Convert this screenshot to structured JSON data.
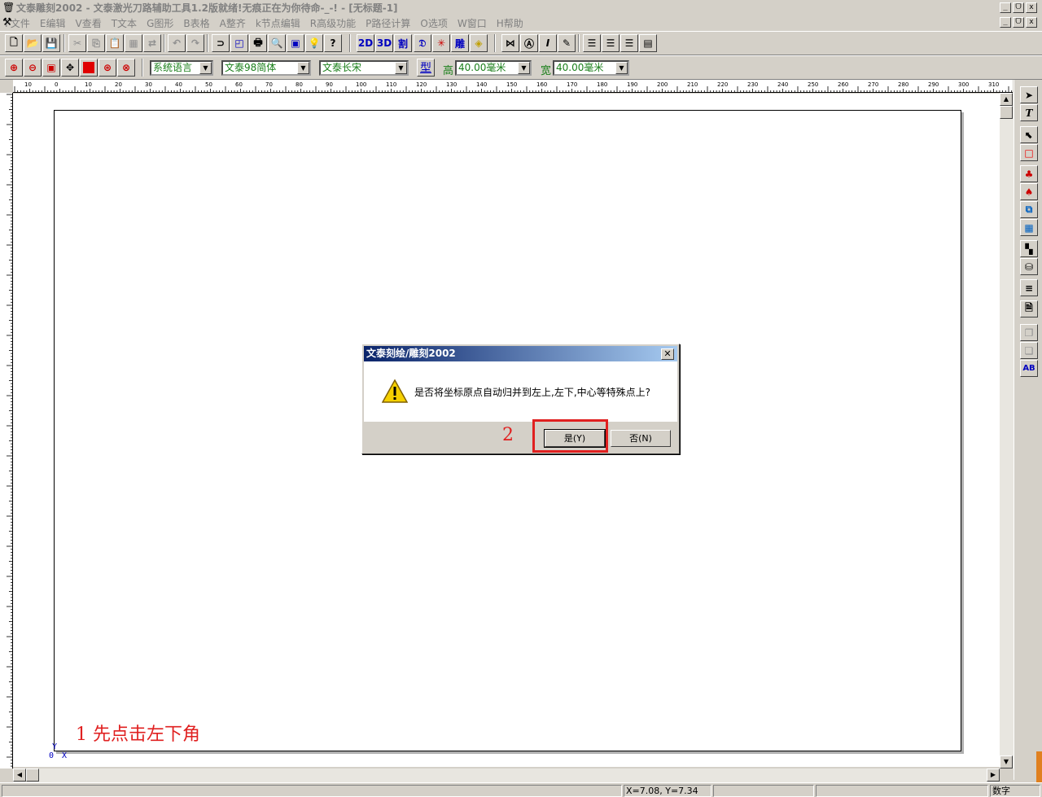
{
  "window": {
    "title": "文泰雕刻2002 - 文泰激光刀路辅助工具1.2版就绪!无痕正在为你待命-_-! - [无标题-1]",
    "buttons": [
      "_",
      "ᗜ",
      "x"
    ]
  },
  "menu": [
    "F文件",
    "E编辑",
    "V查看",
    "T文本",
    "G图形",
    "B表格",
    "A整齐",
    "k节点编辑",
    "R高级功能",
    "P路径计算",
    "O选项",
    "W窗口",
    "H帮助"
  ],
  "toolbar2": {
    "language": "系统语言",
    "font1": "文泰98简体",
    "font2": "文泰长宋",
    "type_label": "型",
    "height_label": "高",
    "height_value": "40.00毫米",
    "width_label": "宽",
    "width_value": "40.00毫米"
  },
  "toolbar1_text": {
    "b2d": "2D",
    "b3d": "3D",
    "cut": "割",
    "carve": "雕"
  },
  "ruler": {
    "h_labels": [
      "10",
      "0",
      "10",
      "20",
      "30",
      "40",
      "50",
      "60",
      "70",
      "80",
      "90",
      "100",
      "110",
      "120",
      "130",
      "140",
      "150",
      "160",
      "170",
      "180",
      "190",
      "200",
      "210",
      "220",
      "230",
      "240",
      "250",
      "260",
      "270",
      "280",
      "290",
      "300",
      "310"
    ]
  },
  "dialog": {
    "title": "文泰刻绘/雕刻2002",
    "message": "是否将坐标原点自动归并到左上,左下,中心等特殊点上?",
    "yes": "是(Y)",
    "no": "否(N)"
  },
  "annotations": {
    "step1": "1 先点击左下角",
    "step2": "2"
  },
  "origin": {
    "o": "0",
    "x": "X",
    "y": "Y"
  },
  "status": {
    "coords": "X=7.08, Y=7.34",
    "mode": "数字"
  },
  "colors": {
    "highlight": "#e02020",
    "title_gradient_start": "#0a246a",
    "combo_text": "#1a7f1a"
  }
}
